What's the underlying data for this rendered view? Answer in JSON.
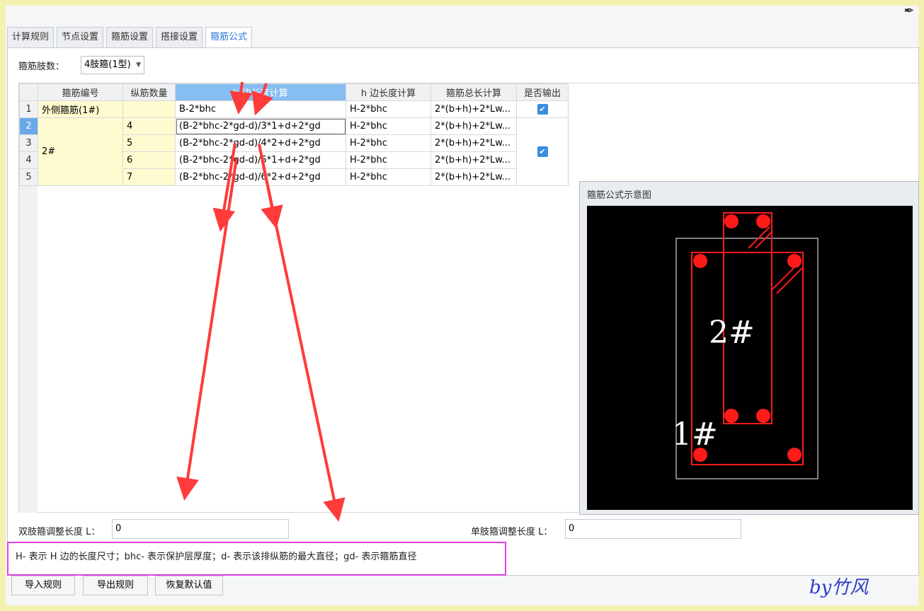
{
  "tabs": [
    {
      "label": "计算规则",
      "active": false
    },
    {
      "label": "节点设置",
      "active": false
    },
    {
      "label": "箍筋设置",
      "active": false
    },
    {
      "label": "搭接设置",
      "active": false
    },
    {
      "label": "箍筋公式",
      "active": true
    }
  ],
  "legs": {
    "label": "箍筋肢数：",
    "value": "4肢箍(1型)"
  },
  "grid": {
    "headers": [
      "箍筋编号",
      "纵筋数量",
      "b 边长度计算",
      "h 边长度计算",
      "箍筋总长计算",
      "是否输出"
    ],
    "rows": [
      {
        "num": "1",
        "id": "外侧箍筋(1#)",
        "count": "",
        "b": "B-2*bhc",
        "h": "H-2*bhc",
        "total": "2*(b+h)+2*Lw..."
      },
      {
        "num": "2",
        "id": "2#",
        "count": "4",
        "b": "(B-2*bhc-2*gd-d)/3*1+d+2*gd",
        "h": "H-2*bhc",
        "total": "2*(b+h)+2*Lw..."
      },
      {
        "num": "3",
        "id": "",
        "count": "5",
        "b": "(B-2*bhc-2*gd-d)/4*2+d+2*gd",
        "h": "H-2*bhc",
        "total": "2*(b+h)+2*Lw..."
      },
      {
        "num": "4",
        "id": "",
        "count": "6",
        "b": "(B-2*bhc-2*gd-d)/5*1+d+2*gd",
        "h": "H-2*bhc",
        "total": "2*(b+h)+2*Lw..."
      },
      {
        "num": "5",
        "id": "",
        "count": "7",
        "b": "(B-2*bhc-2*gd-d)/6*2+d+2*gd",
        "h": "H-2*bhc",
        "total": "2*(b+h)+2*Lw..."
      }
    ]
  },
  "double_adjust": {
    "label": "双肢箍调整长度 L：",
    "value": "0"
  },
  "single_adjust": {
    "label": "单肢箍调整长度 L：",
    "value": "0"
  },
  "legend_text": "H- 表示 H 边的长度尺寸；bhc- 表示保护层厚度；d- 表示该排纵筋的最大直径；gd- 表示箍筋直径",
  "buttons": {
    "import": "导入规则",
    "export": "导出规则",
    "reset": "恢复默认值"
  },
  "preview": {
    "title": "箍筋公式示意图",
    "label_inner": "2#",
    "label_outer": "1#"
  },
  "signature": "by竹风",
  "colors": {
    "accent": "#3a8de0",
    "rebar": "#ff1a1a",
    "annotation": "#ff3b3b",
    "highlight_box": "#e040e0"
  }
}
